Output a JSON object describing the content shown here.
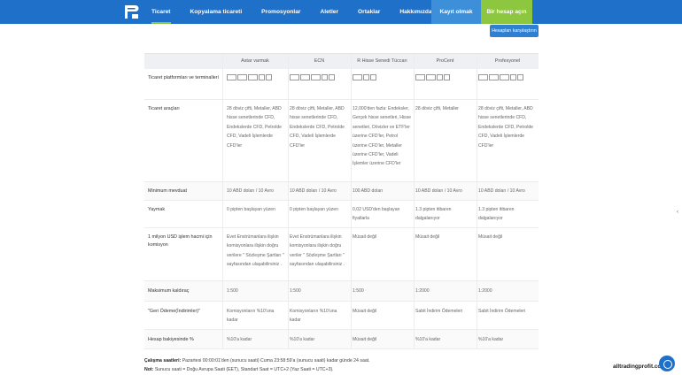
{
  "header": {
    "nav": [
      {
        "label": "Ticaret",
        "active": true
      },
      {
        "label": "Kopyalama ticareti"
      },
      {
        "label": "Promosyonlar"
      },
      {
        "label": "Aletler"
      },
      {
        "label": "Ortaklar"
      },
      {
        "label": "Hakkımızda"
      }
    ],
    "open_account": "Kayıt olmak",
    "demo_account": "Bir hesap açın"
  },
  "compare_button": "Hesapları karşılaştırın",
  "table": {
    "columns": [
      "Astar varmak",
      "ECN",
      "R Hisse Senedi Tüccarı",
      "ProCent",
      "Profesyonel"
    ],
    "rows": [
      {
        "label": "Ticaret platformları ve terminalleri",
        "cells": [
          "",
          "",
          "",
          "",
          ""
        ]
      },
      {
        "label": "Ticaret araçları",
        "cells": [
          "28 döviz çifti, Metaller, ABD hisse senetlerinde CFD, Endekslerde CFD, Petrolde CFD, Vadeli İşlemlerde CFD'ler",
          "28 döviz çifti, Metaller, ABD hisse senetlerinde CFD, Endekslerde CFD, Petrolde CFD, Vadeli İşlemlerde CFD'ler",
          "12,000'den fazla: Endeksler, Gerçek hisse senetleri, Hisse senetleri, Dövizler ve ETF'ler üzerine CFD'ler, Petrol üzerine CFD'ler, Metaller üzerine CFD'ler, Vadeli İşlemler üzerine CFD'ler",
          "28 döviz çifti, Metaller",
          "28 döviz çifti, Metaller, ABD hisse senetlerinde CFD, Endekslerde CFD, Petrolde CFD, Vadeli İşlemlerde CFD'ler"
        ]
      },
      {
        "label": "Minimum mevduat",
        "cells": [
          "10 ABD doları / 10 Avro",
          "10 ABD doları / 10 Avro",
          "100 ABD doları",
          "10 ABD doları / 10 Avro",
          "10 ABD doları / 10 Avro"
        ]
      },
      {
        "label": "Yaymak",
        "cells": [
          "0 pipten başlayan yüzen",
          "0 pipten başlayan yüzen",
          "0,02 USD'den başlayan fiyatlarla",
          "1.3 pipten itibaren dalgalanıyor",
          "1.3 pipten itibaren dalgalanıyor"
        ]
      },
      {
        "label": "1 milyon USD işlem hacmi için komisyon",
        "cells": [
          "Evet Enstrümanlara ilişkin komisyonlara ilişkin doğru verilere \" Sözleşme Şartları \" sayfasından ulaşabilirsiniz .",
          "Evet Enstrümanlara ilişkin komisyonlara ilişkin doğru veriler \" Sözleşme Şartları \" sayfasından ulaşabilirsiniz .",
          "Müsait değil",
          "Müsait değil",
          "Müsait değil"
        ]
      },
      {
        "label": "Maksimum kaldıraç",
        "cells": [
          "1:500",
          "1:500",
          "1:500",
          "1:2000",
          "1:2000"
        ]
      },
      {
        "label": "\"Geri Ödeme(İndirimler)\"",
        "cells": [
          "Komisyonların %10'una kadar",
          "Komisyonların %10'una kadar",
          "Müsait değil",
          "Sabit İndirim Ödemeleri",
          "Sabit İndirim Ödemeleri"
        ]
      },
      {
        "label": "Hesap bakiyesinde %",
        "cells": [
          "%10'a kadar",
          "%10'a kadar",
          "Müsait değil",
          "%10'a kadar",
          "%10'a kadar"
        ]
      }
    ]
  },
  "footer": {
    "hours_label": "Çalışma saatleri:",
    "hours_text": "Pazartesi 00:00:01'den (sunucu saati) Cuma 23:58:59'a (sunucu saati) kadar günde 24 saat.",
    "note_label": "Not:",
    "note_text": "Sunucu saati = Doğu Avrupa Saati (EET), Standart Saat = UTC+2 (Yaz Saati = UTC+3)."
  },
  "watermark": "alltradingprofit.com"
}
